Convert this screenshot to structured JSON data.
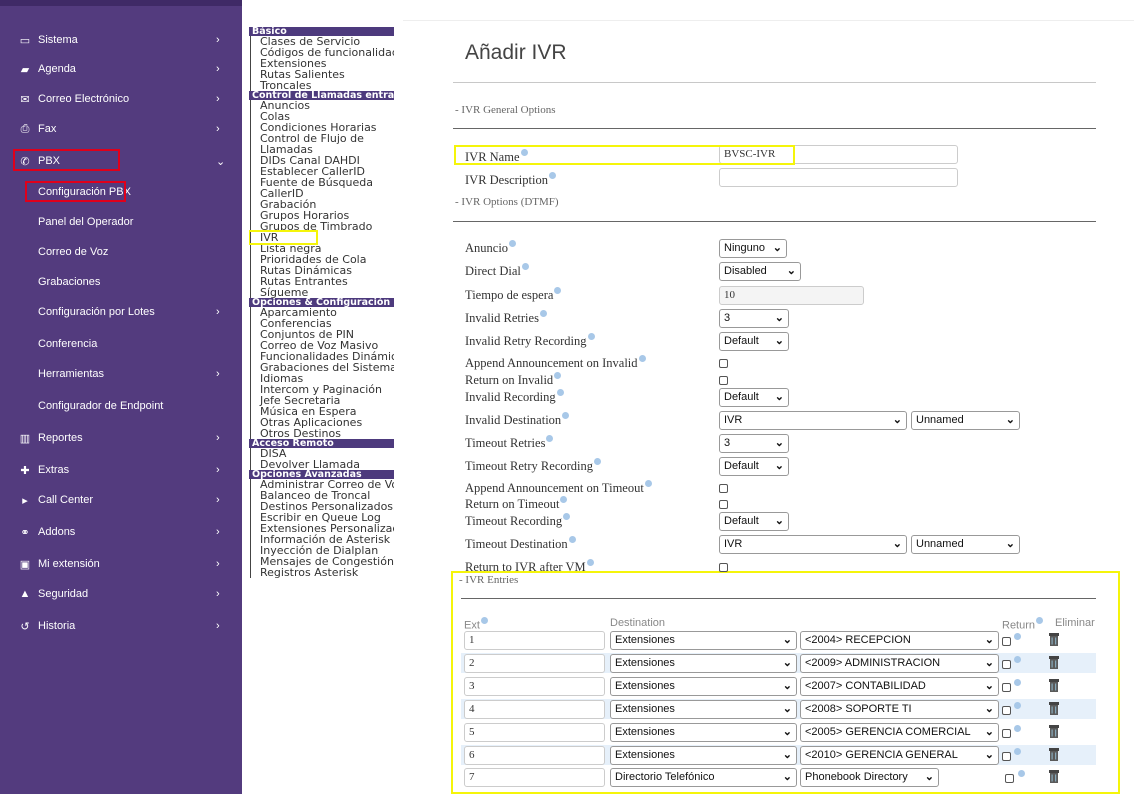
{
  "sidebar": {
    "items": [
      {
        "label": "Sistema",
        "icon": "monitor-icon",
        "arrow": "›"
      },
      {
        "label": "Agenda",
        "icon": "book-icon",
        "arrow": "›"
      },
      {
        "label": "Correo Electrónico",
        "icon": "envelope-icon",
        "arrow": "›"
      },
      {
        "label": "Fax",
        "icon": "printer-icon",
        "arrow": "›"
      },
      {
        "label": "PBX",
        "icon": "phone-icon",
        "arrow": "⌄"
      },
      {
        "label": "Configuración PBX"
      },
      {
        "label": "Panel del Operador"
      },
      {
        "label": "Correo de Voz"
      },
      {
        "label": "Grabaciones"
      },
      {
        "label": "Configuración por Lotes",
        "arrow": "›"
      },
      {
        "label": "Conferencia"
      },
      {
        "label": "Herramientas",
        "arrow": "›"
      },
      {
        "label": "Configurador de Endpoint"
      },
      {
        "label": "Reportes",
        "icon": "chart-icon",
        "arrow": "›"
      },
      {
        "label": "Extras",
        "icon": "plus-icon",
        "arrow": "›"
      },
      {
        "label": "Call Center",
        "icon": "caret-right-icon",
        "arrow": "›"
      },
      {
        "label": "Addons",
        "icon": "addons-icon",
        "arrow": "›"
      },
      {
        "label": "Mi extensión",
        "icon": "id-card-icon",
        "arrow": "›"
      },
      {
        "label": "Seguridad",
        "icon": "lock-icon",
        "arrow": "›"
      },
      {
        "label": "Historia",
        "icon": "history-icon",
        "arrow": "›"
      }
    ]
  },
  "midmenu": {
    "groups": [
      {
        "header": "Básico",
        "links": [
          "Clases de Servicio",
          "Códigos de funcionalidad",
          "Extensiones",
          "Rutas Salientes",
          "Troncales"
        ]
      },
      {
        "header": "Control de Llamadas entrantes",
        "links": [
          "Anuncios",
          "Colas",
          "Condiciones Horarias",
          "Control de Flujo de Llamadas",
          "DIDs Canal DAHDI",
          "Establecer CallerID",
          "Fuente de Búsqueda CallerID",
          "Grabación",
          "Grupos Horarios",
          "Grupos de Timbrado",
          "IVR",
          "Lista negra",
          "Prioridades de Cola",
          "Rutas Dinámicas",
          "Rutas Entrantes",
          "Sígueme"
        ]
      },
      {
        "header": "Opciones & Configuración",
        "links": [
          "Aparcamiento",
          "Conferencias",
          "Conjuntos de PIN",
          "Correo de Voz Masivo",
          "Funcionalidades Dinámicas",
          "Grabaciones del Sistema",
          "Idiomas",
          "Intercom y Paginación",
          "Jefe Secretaria",
          "Música en Espera",
          "Otras Aplicaciones",
          "Otros Destinos"
        ]
      },
      {
        "header": "Acceso Remoto",
        "links": [
          "DISA",
          "Devolver Llamada"
        ]
      },
      {
        "header": "Opciones Avanzadas",
        "links": [
          "Administrar Correo de Voz",
          "Balanceo de Troncal",
          "Destinos Personalizados",
          "Escribir en Queue Log",
          "Extensiones Personalizadas",
          "Información de Asterisk",
          "Inyección de Dialplan",
          "Mensajes de Congestión",
          "Registros Asterisk"
        ]
      }
    ]
  },
  "page": {
    "title": "Añadir IVR",
    "general_section": "- IVR General Options",
    "dtmf_section": "- IVR Options (DTMF)",
    "entries_section": "- IVR Entries"
  },
  "form": {
    "ivr_name": {
      "label": "IVR Name",
      "value": "BVSC-IVR"
    },
    "ivr_description": {
      "label": "IVR Description",
      "value": ""
    },
    "anuncio": {
      "label": "Anuncio",
      "value": "Ninguno"
    },
    "direct_dial": {
      "label": "Direct Dial",
      "value": "Disabled"
    },
    "tiempo_espera": {
      "label": "Tiempo de espera",
      "value": "10"
    },
    "invalid_retries": {
      "label": "Invalid Retries",
      "value": "3"
    },
    "invalid_retry_recording": {
      "label": "Invalid Retry Recording",
      "value": "Default"
    },
    "append_invalid": {
      "label": "Append Announcement on Invalid"
    },
    "return_invalid": {
      "label": "Return on Invalid"
    },
    "invalid_recording": {
      "label": "Invalid Recording",
      "value": "Default"
    },
    "invalid_destination": {
      "label": "Invalid Destination",
      "value": "IVR",
      "value2": "Unnamed"
    },
    "timeout_retries": {
      "label": "Timeout Retries",
      "value": "3"
    },
    "timeout_retry_recording": {
      "label": "Timeout Retry Recording",
      "value": "Default"
    },
    "append_timeout": {
      "label": "Append Announcement on Timeout"
    },
    "return_timeout": {
      "label": "Return on Timeout"
    },
    "timeout_recording": {
      "label": "Timeout Recording",
      "value": "Default"
    },
    "timeout_destination": {
      "label": "Timeout Destination",
      "value": "IVR",
      "value2": "Unnamed"
    },
    "return_after_vm": {
      "label": "Return to IVR after VM"
    }
  },
  "entries": {
    "headers": {
      "ext": "Ext",
      "destination": "Destination",
      "return": "Return",
      "eliminar": "Eliminar"
    },
    "rows": [
      {
        "ext": "1",
        "type": "Extensiones",
        "target": "<2004> RECEPCION"
      },
      {
        "ext": "2",
        "type": "Extensiones",
        "target": "<2009> ADMINISTRACION"
      },
      {
        "ext": "3",
        "type": "Extensiones",
        "target": "<2007> CONTABILIDAD"
      },
      {
        "ext": "4",
        "type": "Extensiones",
        "target": "<2008> SOPORTE TI"
      },
      {
        "ext": "5",
        "type": "Extensiones",
        "target": "<2005> GERENCIA COMERCIAL"
      },
      {
        "ext": "6",
        "type": "Extensiones",
        "target": "<2010> GERENCIA GENERAL"
      },
      {
        "ext": "7",
        "type": "Directorio Telefónico",
        "target": "Phonebook Directory"
      }
    ]
  },
  "colors": {
    "sidebar": "#533b7e",
    "menu_header": "#4d3a7d",
    "highlight_red": "#e0001b",
    "highlight_yellow": "#f5f50a"
  }
}
